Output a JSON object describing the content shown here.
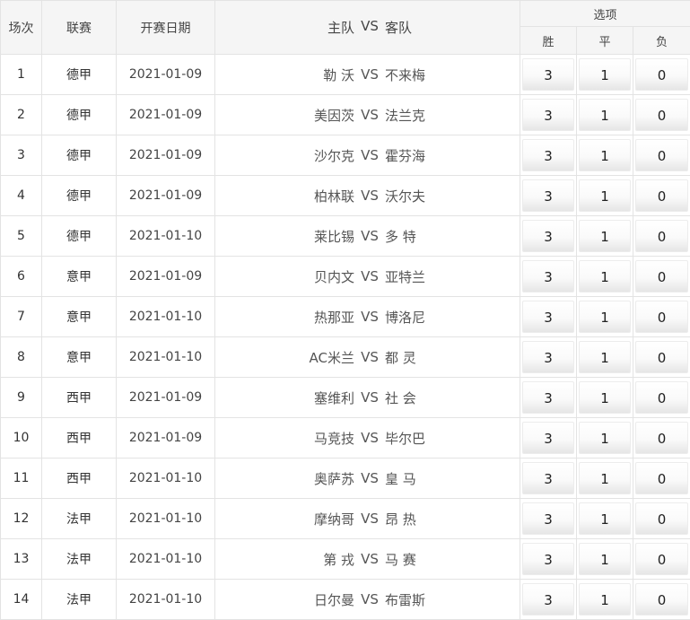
{
  "headers": {
    "no": "场次",
    "league": "联赛",
    "date": "开赛日期",
    "home": "主队",
    "vs": "VS",
    "away": "客队",
    "options": "选项",
    "win": "胜",
    "draw": "平",
    "lose": "负"
  },
  "rows": [
    {
      "no": "1",
      "league": "德甲",
      "date": "2021-01-09",
      "home": "勒 沃",
      "vs": "VS",
      "away": "不来梅",
      "win": "3",
      "draw": "1",
      "lose": "0"
    },
    {
      "no": "2",
      "league": "德甲",
      "date": "2021-01-09",
      "home": "美因茨",
      "vs": "VS",
      "away": "法兰克",
      "win": "3",
      "draw": "1",
      "lose": "0"
    },
    {
      "no": "3",
      "league": "德甲",
      "date": "2021-01-09",
      "home": "沙尔克",
      "vs": "VS",
      "away": "霍芬海",
      "win": "3",
      "draw": "1",
      "lose": "0"
    },
    {
      "no": "4",
      "league": "德甲",
      "date": "2021-01-09",
      "home": "柏林联",
      "vs": "VS",
      "away": "沃尔夫",
      "win": "3",
      "draw": "1",
      "lose": "0"
    },
    {
      "no": "5",
      "league": "德甲",
      "date": "2021-01-10",
      "home": "莱比锡",
      "vs": "VS",
      "away": "多 特",
      "win": "3",
      "draw": "1",
      "lose": "0"
    },
    {
      "no": "6",
      "league": "意甲",
      "date": "2021-01-09",
      "home": "贝内文",
      "vs": "VS",
      "away": "亚特兰",
      "win": "3",
      "draw": "1",
      "lose": "0"
    },
    {
      "no": "7",
      "league": "意甲",
      "date": "2021-01-10",
      "home": "热那亚",
      "vs": "VS",
      "away": "博洛尼",
      "win": "3",
      "draw": "1",
      "lose": "0"
    },
    {
      "no": "8",
      "league": "意甲",
      "date": "2021-01-10",
      "home": "AC米兰",
      "vs": "VS",
      "away": "都 灵",
      "win": "3",
      "draw": "1",
      "lose": "0"
    },
    {
      "no": "9",
      "league": "西甲",
      "date": "2021-01-09",
      "home": "塞维利",
      "vs": "VS",
      "away": "社 会",
      "win": "3",
      "draw": "1",
      "lose": "0"
    },
    {
      "no": "10",
      "league": "西甲",
      "date": "2021-01-09",
      "home": "马竞技",
      "vs": "VS",
      "away": "毕尔巴",
      "win": "3",
      "draw": "1",
      "lose": "0"
    },
    {
      "no": "11",
      "league": "西甲",
      "date": "2021-01-10",
      "home": "奥萨苏",
      "vs": "VS",
      "away": "皇 马",
      "win": "3",
      "draw": "1",
      "lose": "0"
    },
    {
      "no": "12",
      "league": "法甲",
      "date": "2021-01-10",
      "home": "摩纳哥",
      "vs": "VS",
      "away": "昂 热",
      "win": "3",
      "draw": "1",
      "lose": "0"
    },
    {
      "no": "13",
      "league": "法甲",
      "date": "2021-01-10",
      "home": "第 戎",
      "vs": "VS",
      "away": "马 赛",
      "win": "3",
      "draw": "1",
      "lose": "0"
    },
    {
      "no": "14",
      "league": "法甲",
      "date": "2021-01-10",
      "home": "日尔曼",
      "vs": "VS",
      "away": "布雷斯",
      "win": "3",
      "draw": "1",
      "lose": "0"
    }
  ]
}
